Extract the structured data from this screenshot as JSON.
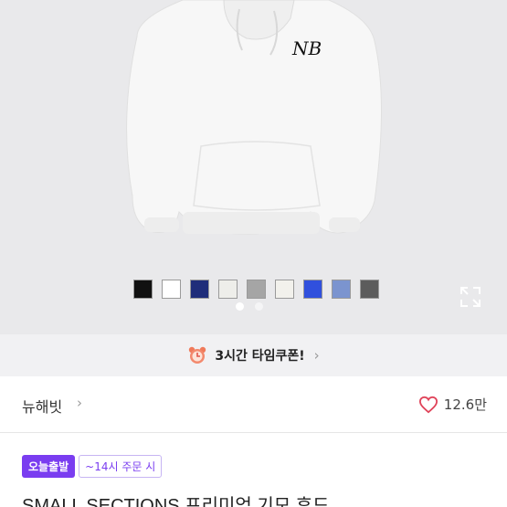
{
  "product_image": {
    "logo_text": "NB",
    "swatches": [
      {
        "name": "black",
        "color": "#111111"
      },
      {
        "name": "white",
        "color": "#ffffff"
      },
      {
        "name": "navy",
        "color": "#1f2d7a"
      },
      {
        "name": "ivory",
        "color": "#eeeeea"
      },
      {
        "name": "gray",
        "color": "#a5a5a5"
      },
      {
        "name": "cream",
        "color": "#f2f1ec"
      },
      {
        "name": "blue",
        "color": "#3050dd"
      },
      {
        "name": "sky",
        "color": "#7b94cf"
      },
      {
        "name": "charcoal",
        "color": "#5c5c5c"
      }
    ],
    "carousel_dots": 2,
    "carousel_active": 0
  },
  "coupon_banner": {
    "icon": "alarm-clock-icon",
    "label": "3시간 타임쿠폰!"
  },
  "shop": {
    "name": "뉴해빗",
    "likes": "12.6만"
  },
  "badges": {
    "today": "오늘출발",
    "order_cutoff": "~14시 주문 시"
  },
  "product": {
    "title": "SMALL SECTIONS 프리미엄 기모 후드"
  },
  "colors": {
    "accent": "#7a3df0",
    "heart": "#e0445a"
  }
}
